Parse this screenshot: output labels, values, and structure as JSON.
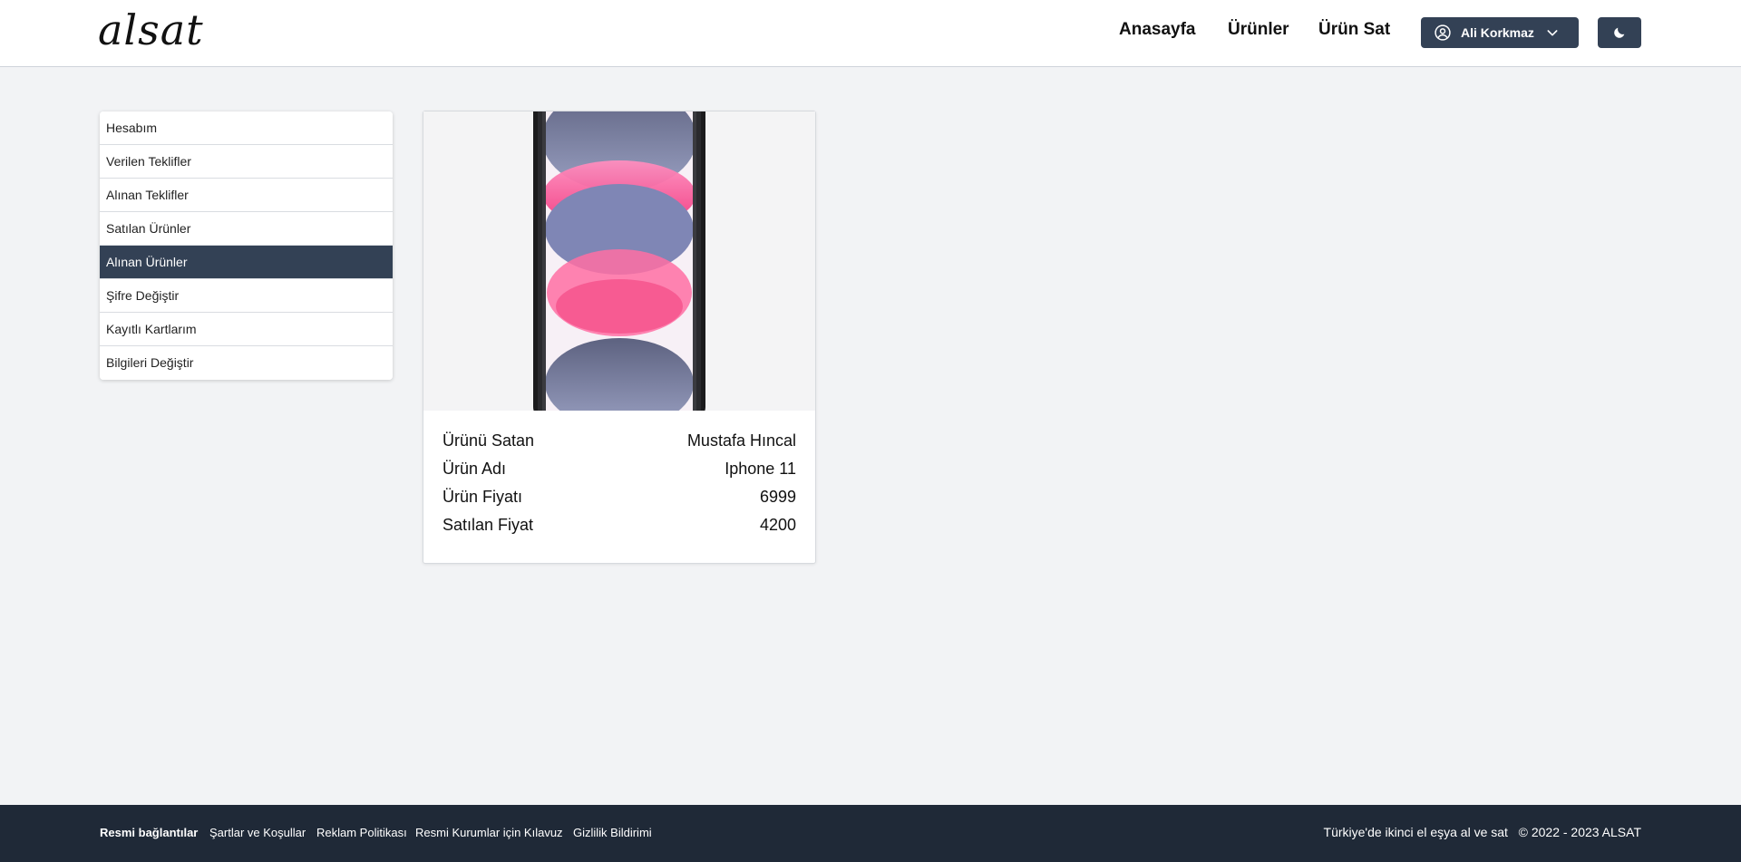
{
  "header": {
    "logo": "alsat",
    "nav": [
      "Anasayfa",
      "Ürünler",
      "Ürün Sat"
    ],
    "user_name": "Ali Korkmaz"
  },
  "sidebar": {
    "items": [
      {
        "label": "Hesabım",
        "active": false
      },
      {
        "label": "Verilen Teklifler",
        "active": false
      },
      {
        "label": "Alınan Teklifler",
        "active": false
      },
      {
        "label": "Satılan Ürünler",
        "active": false
      },
      {
        "label": "Alınan Ürünler",
        "active": true
      },
      {
        "label": "Şifre Değiştir",
        "active": false
      },
      {
        "label": "Kayıtlı Kartlarım",
        "active": false
      },
      {
        "label": "Bilgileri Değiştir",
        "active": false
      }
    ]
  },
  "product": {
    "rows": [
      {
        "label": "Ürünü Satan",
        "value": "Mustafa Hıncal"
      },
      {
        "label": "Ürün Adı",
        "value": "Iphone 11"
      },
      {
        "label": "Ürün Fiyatı",
        "value": "6999"
      },
      {
        "label": "Satılan Fiyat",
        "value": "4200"
      }
    ]
  },
  "footer": {
    "title": "Resmi bağlantılar",
    "links": [
      "Şartlar ve Koşullar",
      "Reklam Politikası",
      "Resmi Kurumlar için Kılavuz",
      "Gizlilik Bildirimi"
    ],
    "tagline": "Türkiye'de ikinci el eşya al ve sat",
    "copyright": "© 2022 - 2023 ALSAT"
  },
  "colors": {
    "accent": "#334155",
    "footer_bg": "#1f2937",
    "page_bg": "#f2f3f5"
  }
}
